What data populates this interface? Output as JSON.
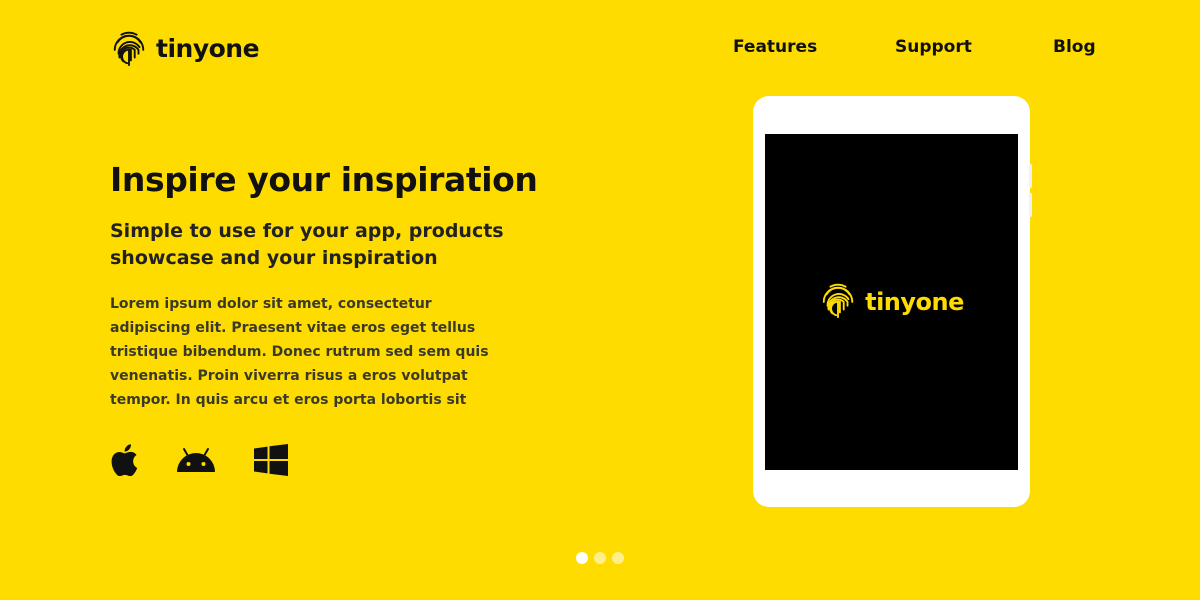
{
  "brand": {
    "name": "tinyone",
    "icon": "fingerprint-icon"
  },
  "nav": {
    "items": [
      {
        "label": "Features"
      },
      {
        "label": "Support"
      },
      {
        "label": "Blog"
      }
    ]
  },
  "hero": {
    "title": "Inspire your inspiration",
    "subtitle": "Simple to use for your app, products showcase and your inspiration",
    "body": "Lorem ipsum dolor sit amet, consectetur adipiscing elit. Praesent vitae eros eget tellus tristique bibendum. Donec rutrum sed sem quis venenatis. Proin viverra risus a eros volutpat tempor. In quis arcu et eros porta lobortis sit",
    "platforms": [
      "apple-icon",
      "android-icon",
      "windows-icon"
    ]
  },
  "device": {
    "screen_brand": "tinyone"
  },
  "slider": {
    "count": 3,
    "active_index": 0
  },
  "colors": {
    "background": "#FEDC00",
    "text": "#111111",
    "screen": "#000000",
    "accent": "#FEDC00"
  }
}
